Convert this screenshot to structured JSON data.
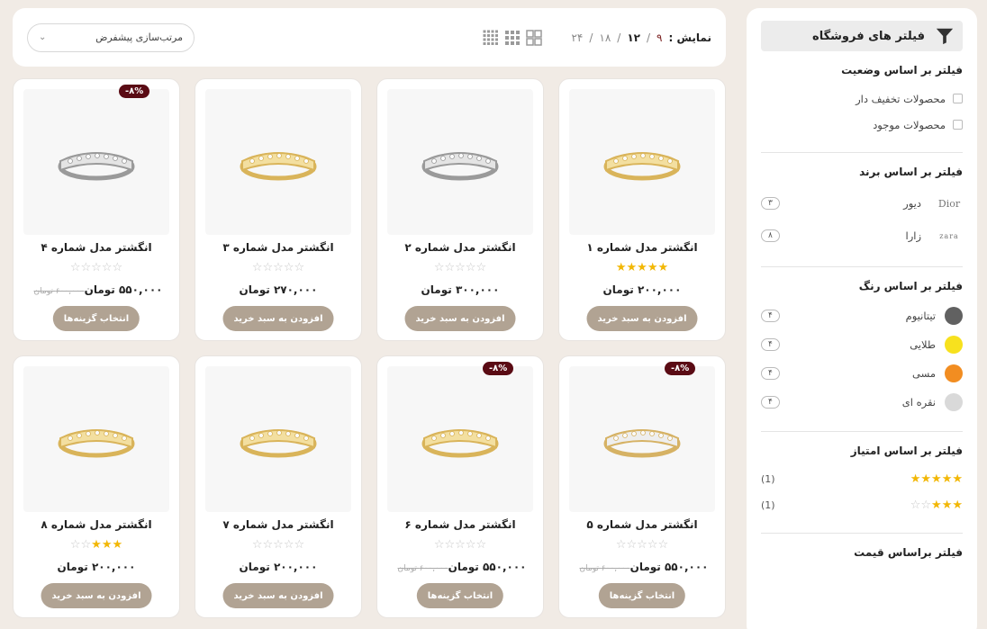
{
  "topbar": {
    "show_label": "نمایش :",
    "page_sizes": [
      "۹",
      "۱۲",
      "۱۸",
      "۲۴"
    ],
    "separator": "/",
    "sort_value": "مرتب‌سازی پیشفرض"
  },
  "sidebar": {
    "title": "فیلتر های فروشگاه",
    "status": {
      "title": "فیلتر بر اساس وضعیت",
      "options": [
        "محصولات تخفیف دار",
        "محصولات موجود"
      ]
    },
    "brand": {
      "title": "فیلتر بر اساس برند",
      "items": [
        {
          "logo": "Dior",
          "name": "دیور",
          "count": "۳"
        },
        {
          "logo": "zara",
          "name": "زارا",
          "count": "۸"
        }
      ]
    },
    "color": {
      "title": "فیلتر بر اساس رنگ",
      "items": [
        {
          "name": "تیتانیوم",
          "hex": "#616161",
          "count": "۴"
        },
        {
          "name": "طلایی",
          "hex": "#f7e11e",
          "count": "۴"
        },
        {
          "name": "مسی",
          "hex": "#f28d21",
          "count": "۴"
        },
        {
          "name": "نقره ای",
          "hex": "#d9d9d9",
          "count": "۴"
        }
      ]
    },
    "rating": {
      "title": "فیلتر بر اساس امتیاز",
      "items": [
        {
          "stars": 5,
          "count": "(1)"
        },
        {
          "stars": 3,
          "count": "(1)"
        }
      ]
    },
    "price": {
      "title": "فیلتر براساس قیمت"
    }
  },
  "products": [
    {
      "name": "انگشتر مدل شماره ۱",
      "rating": 5,
      "price": "۲۰۰,۰۰۰ تومان",
      "old_price": "",
      "badge": "",
      "button": "افزودن به سبد خرید",
      "metal": "gold"
    },
    {
      "name": "انگشتر مدل شماره ۲",
      "rating": 0,
      "price": "۳۰۰,۰۰۰ تومان",
      "old_price": "",
      "badge": "",
      "button": "افزودن به سبد خرید",
      "metal": "silver"
    },
    {
      "name": "انگشتر مدل شماره ۳",
      "rating": 0,
      "price": "۲۷۰,۰۰۰ تومان",
      "old_price": "",
      "badge": "",
      "button": "افزودن به سبد خرید",
      "metal": "gold"
    },
    {
      "name": "انگشتر مدل شماره ۴",
      "rating": 0,
      "price": "۵۵۰,۰۰۰ تومان",
      "old_price": "۶۰۰,۰۰۰ تومان",
      "badge": "-۸%",
      "button": "انتخاب گزینه‌ها",
      "metal": "silver"
    },
    {
      "name": "انگشتر مدل شماره ۵",
      "rating": 0,
      "price": "۵۵۰,۰۰۰ تومان",
      "old_price": "۶۰۰,۰۰۰ تومان",
      "badge": "-۸%",
      "button": "انتخاب گزینه‌ها",
      "metal": "mixed"
    },
    {
      "name": "انگشتر مدل شماره ۶",
      "rating": 0,
      "price": "۵۵۰,۰۰۰ تومان",
      "old_price": "۶۰۰,۰۰۰ تومان",
      "badge": "-۸%",
      "button": "انتخاب گزینه‌ها",
      "metal": "gold"
    },
    {
      "name": "انگشتر مدل شماره ۷",
      "rating": 0,
      "price": "۲۰۰,۰۰۰ تومان",
      "old_price": "",
      "badge": "",
      "button": "افزودن به سبد خرید",
      "metal": "gold"
    },
    {
      "name": "انگشتر مدل شماره ۸",
      "rating": 3,
      "price": "۲۰۰,۰۰۰ تومان",
      "old_price": "",
      "badge": "",
      "button": "افزودن به سبد خرید",
      "metal": "gold"
    }
  ],
  "colors": {
    "accent_badge": "#5a0b14",
    "button": "#b1a393",
    "star": "#f2b705"
  }
}
